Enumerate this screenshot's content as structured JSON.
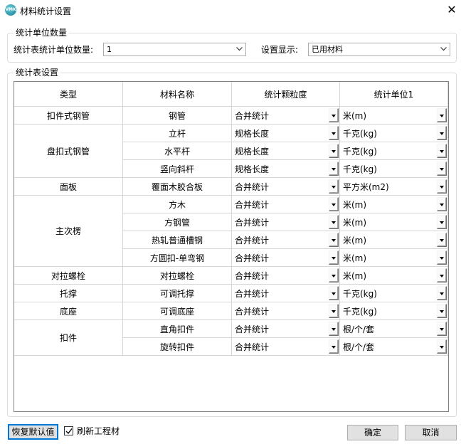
{
  "window": {
    "title": "材料统计设置",
    "app_icon_text": "VMK",
    "close_symbol": "✕"
  },
  "unit_group": {
    "legend": "统计单位数量",
    "count_label": "统计表统计单位数量:",
    "count_value": "1",
    "display_label": "设置显示:",
    "display_value": "已用材料"
  },
  "table_group": {
    "legend": "统计表设置"
  },
  "table": {
    "headers": [
      "类型",
      "材料名称",
      "统计颗粒度",
      "统计单位1"
    ],
    "groups": [
      {
        "type": "扣件式钢管",
        "rows": [
          {
            "name": "钢管",
            "granularity": "合并统计",
            "unit": "米(m)"
          }
        ]
      },
      {
        "type": "盘扣式钢管",
        "rows": [
          {
            "name": "立杆",
            "granularity": "规格长度",
            "unit": "千克(kg)"
          },
          {
            "name": "水平杆",
            "granularity": "规格长度",
            "unit": "千克(kg)"
          },
          {
            "name": "竖向斜杆",
            "granularity": "规格长度",
            "unit": "千克(kg)"
          }
        ]
      },
      {
        "type": "面板",
        "rows": [
          {
            "name": "覆面木胶合板",
            "granularity": "合并统计",
            "unit": "平方米(m2)"
          }
        ]
      },
      {
        "type": "主次楞",
        "rows": [
          {
            "name": "方木",
            "granularity": "合并统计",
            "unit": "米(m)"
          },
          {
            "name": "方钢管",
            "granularity": "合并统计",
            "unit": "米(m)"
          },
          {
            "name": "热轧普通槽钢",
            "granularity": "合并统计",
            "unit": "米(m)"
          },
          {
            "name": "方圆扣-单弯钢",
            "granularity": "合并统计",
            "unit": "米(m)"
          }
        ]
      },
      {
        "type": "对拉螺栓",
        "rows": [
          {
            "name": "对拉螺栓",
            "granularity": "合并统计",
            "unit": "米(m)"
          }
        ]
      },
      {
        "type": "托撑",
        "rows": [
          {
            "name": "可调托撑",
            "granularity": "合并统计",
            "unit": "千克(kg)"
          }
        ]
      },
      {
        "type": "底座",
        "rows": [
          {
            "name": "可调底座",
            "granularity": "合并统计",
            "unit": "千克(kg)"
          }
        ]
      },
      {
        "type": "扣件",
        "rows": [
          {
            "name": "直角扣件",
            "granularity": "合并统计",
            "unit": "根/个/套"
          },
          {
            "name": "旋转扣件",
            "granularity": "合并统计",
            "unit": "根/个/套"
          }
        ]
      }
    ]
  },
  "footer": {
    "restore_label": "恢复默认值",
    "refresh_label": "刷新工程材",
    "refresh_checked": true,
    "ok_label": "确定",
    "cancel_label": "取消"
  }
}
